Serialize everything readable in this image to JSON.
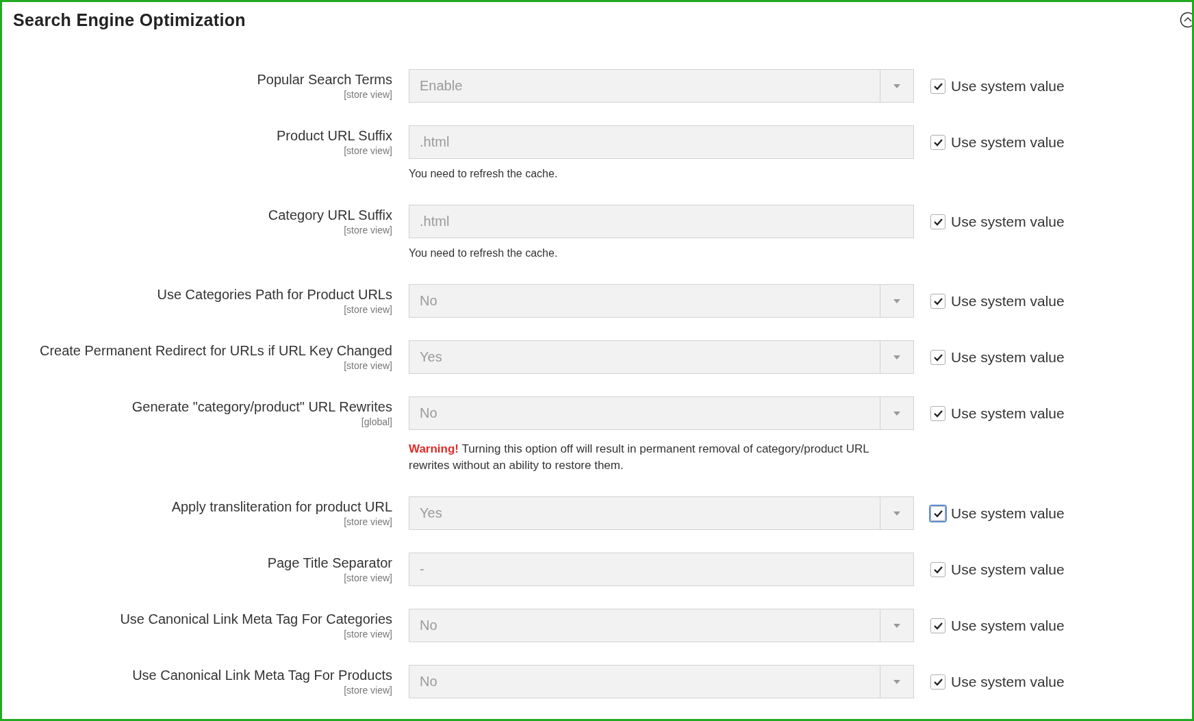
{
  "section": {
    "title": "Search Engine Optimization",
    "expanded": true
  },
  "rows": [
    {
      "label": "Popular Search Terms",
      "scope": "[store view]",
      "kind": "select",
      "value": "Enable",
      "use_system_value": {
        "label": "Use system value",
        "checked": true,
        "focused": false
      }
    },
    {
      "label": "Product URL Suffix",
      "scope": "[store view]",
      "kind": "text",
      "value": ".html",
      "note": "You need to refresh the cache.",
      "use_system_value": {
        "label": "Use system value",
        "checked": true,
        "focused": false
      }
    },
    {
      "label": "Category URL Suffix",
      "scope": "[store view]",
      "kind": "text",
      "value": ".html",
      "note": "You need to refresh the cache.",
      "use_system_value": {
        "label": "Use system value",
        "checked": true,
        "focused": false
      }
    },
    {
      "label": "Use Categories Path for Product URLs",
      "scope": "[store view]",
      "kind": "select",
      "value": "No",
      "use_system_value": {
        "label": "Use system value",
        "checked": true,
        "focused": false
      }
    },
    {
      "label": "Create Permanent Redirect for URLs if URL Key Changed",
      "scope": "[store view]",
      "kind": "select",
      "value": "Yes",
      "use_system_value": {
        "label": "Use system value",
        "checked": true,
        "focused": false
      }
    },
    {
      "label": "Generate \"category/product\" URL Rewrites",
      "scope": "[global]",
      "kind": "select",
      "value": "No",
      "warning": {
        "label": "Warning!",
        "text": "Turning this option off will result in permanent removal of category/product URL rewrites without an ability to restore them."
      },
      "use_system_value": {
        "label": "Use system value",
        "checked": true,
        "focused": false
      }
    },
    {
      "label": "Apply transliteration for product URL",
      "scope": "[store view]",
      "kind": "select",
      "value": "Yes",
      "use_system_value": {
        "label": "Use system value",
        "checked": true,
        "focused": true
      }
    },
    {
      "label": "Page Title Separator",
      "scope": "[store view]",
      "kind": "text",
      "value": "-",
      "use_system_value": {
        "label": "Use system value",
        "checked": true,
        "focused": false
      }
    },
    {
      "label": "Use Canonical Link Meta Tag For Categories",
      "scope": "[store view]",
      "kind": "select",
      "value": "No",
      "use_system_value": {
        "label": "Use system value",
        "checked": true,
        "focused": false
      }
    },
    {
      "label": "Use Canonical Link Meta Tag For Products",
      "scope": "[store view]",
      "kind": "select",
      "value": "No",
      "use_system_value": {
        "label": "Use system value",
        "checked": true,
        "focused": false
      }
    }
  ]
}
